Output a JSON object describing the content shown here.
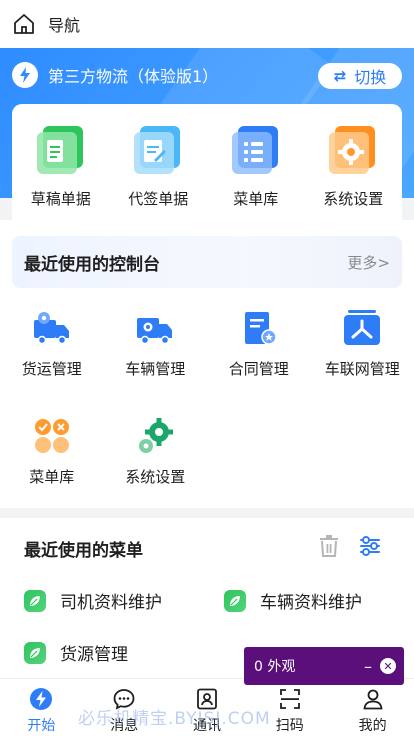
{
  "header": {
    "title": "导航"
  },
  "org": {
    "name": "第三方物流（体验版1）",
    "switch_label": "切换"
  },
  "shortcuts": [
    {
      "label": "草稿单据",
      "icon": "draft-document-icon",
      "color": "#2ec55d"
    },
    {
      "label": "代签单据",
      "icon": "proxy-sign-document-icon",
      "color": "#4fc3f7"
    },
    {
      "label": "菜单库",
      "icon": "menu-library-icon",
      "color": "#2f7df6"
    },
    {
      "label": "系统设置",
      "icon": "settings-icon",
      "color": "#ff9a2e"
    }
  ],
  "console": {
    "title": "最近使用的控制台",
    "more": "更多>",
    "items": [
      {
        "label": "货运管理",
        "icon": "freight-truck-icon"
      },
      {
        "label": "车辆管理",
        "icon": "vehicle-truck-icon"
      },
      {
        "label": "合同管理",
        "icon": "contract-icon"
      },
      {
        "label": "车联网管理",
        "icon": "vehicle-network-icon"
      },
      {
        "label": "菜单库",
        "icon": "menu-library-icon"
      },
      {
        "label": "系统设置",
        "icon": "gear-icon"
      }
    ]
  },
  "recent_menus": {
    "title": "最近使用的菜单",
    "items": [
      {
        "label": "司机资料维护"
      },
      {
        "label": "车辆资料维护"
      },
      {
        "label": "货源管理"
      }
    ]
  },
  "tabs": [
    {
      "label": "开始",
      "icon": "start-icon",
      "active": true
    },
    {
      "label": "消息",
      "icon": "message-icon",
      "active": false
    },
    {
      "label": "通讯",
      "icon": "contacts-icon",
      "active": false
    },
    {
      "label": "扫码",
      "icon": "scan-icon",
      "active": false
    },
    {
      "label": "我的",
      "icon": "profile-icon",
      "active": false
    }
  ],
  "float_widget": {
    "text": "0 外观",
    "minimize": "–"
  },
  "watermark": "必乐机精宝.BYJSJ.COM",
  "colors": {
    "primary": "#2f7df6",
    "hero_gradient_start": "#2f8cff",
    "widget_bg": "#5b0f7a",
    "leaf_green": "#2ec55d"
  }
}
